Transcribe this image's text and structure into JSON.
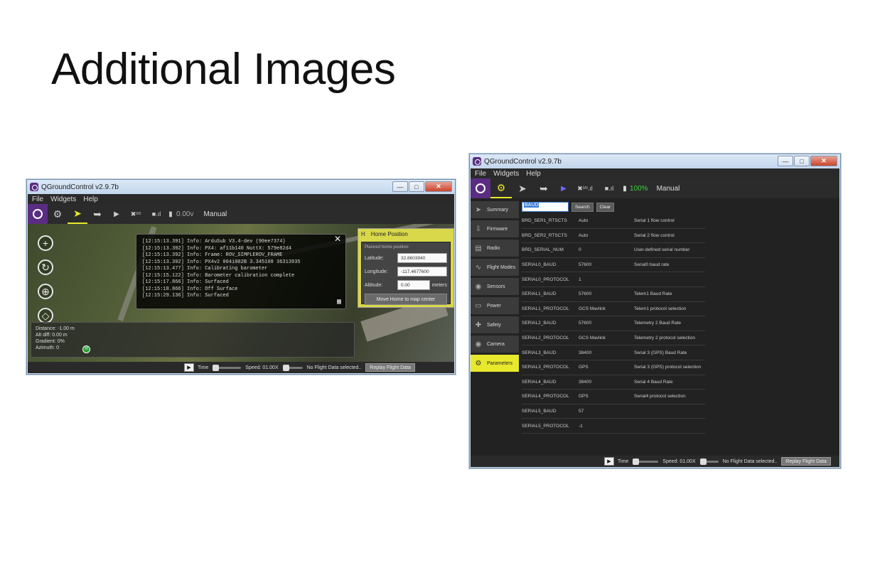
{
  "slide": {
    "title": "Additional Images"
  },
  "window_left": {
    "title": "QGroundControl v2.9.7b",
    "menu": [
      "File",
      "Widgets",
      "Help"
    ],
    "toolbar": {
      "sats": "0/0",
      "voltage": "0.00v",
      "mode": "Manual"
    },
    "console_lines": [
      "[12:15:13.391] Info: ArduSub V3.4-dev (90ee7374)",
      "[12:15:13.392] Info: PX4: af11b140 NuttX: 579e82d4",
      "[12:15:13.392] Info: Frame: ROV_SIMPLEROV_FRAME",
      "[12:15:13.392] Info: PX4v2 004i002B 3.345108 36313935",
      "[12:15:13.477] Info: Calibrating barometer",
      "[12:15:15.122] Info: Barometer calibration complete",
      "[12:15:17.866] Info: Surfaced",
      "[12:15:18.866] Info: Off Surface",
      "[12:15:29.136] Info: Surfaced"
    ],
    "home": {
      "heading": "Home Position",
      "subtitle": "Planned home position:",
      "latitude_label": "Latitude:",
      "latitude": "32.8603940",
      "longitude_label": "Longitude:",
      "longitude": "-117.4677600",
      "altitude_label": "Altitude:",
      "altitude": "0.00",
      "altitude_unit": "meters",
      "move_button": "Move Home to map center"
    },
    "telemetry": {
      "distance": "Distance:   -1.00 m",
      "alt_diff": "Alt diff:    0.00 m",
      "gradient": "Gradient:   0%",
      "azimuth": "Azimuth:    0",
      "home_marker": "H"
    },
    "replay": {
      "time": "Time",
      "speed": "Speed: 01.00X",
      "status": "No Flight Data selected..",
      "button": "Replay Flight Data"
    }
  },
  "window_right": {
    "title": "QGroundControl v2.9.7b",
    "menu": [
      "File",
      "Widgets",
      "Help"
    ],
    "toolbar": {
      "sats": "0/0",
      "battery": "100%",
      "mode": "Manual"
    },
    "sidebar": [
      {
        "label": "Summary",
        "icon": "plane-icon"
      },
      {
        "label": "Firmware",
        "icon": "download-icon"
      },
      {
        "label": "Radio",
        "icon": "radio-icon"
      },
      {
        "label": "Flight Modes",
        "icon": "wave-icon"
      },
      {
        "label": "Sensors",
        "icon": "sensor-icon"
      },
      {
        "label": "Power",
        "icon": "battery-icon"
      },
      {
        "label": "Safety",
        "icon": "plus-icon"
      },
      {
        "label": "Camera",
        "icon": "camera-icon"
      },
      {
        "label": "Parameters",
        "icon": "gears-icon"
      }
    ],
    "search": {
      "value": "BAUD",
      "search_button": "Search",
      "clear_button": "Clear"
    },
    "params": [
      {
        "name": "BRD_SER1_RTSCTS",
        "value": "Auto",
        "desc": "Serial 1 flow control"
      },
      {
        "name": "BRD_SER2_RTSCTS",
        "value": "Auto",
        "desc": "Serial 2 flow control"
      },
      {
        "name": "BRD_SERIAL_NUM",
        "value": "0",
        "desc": "User-defined serial number"
      },
      {
        "name": "SERIAL0_BAUD",
        "value": "57600",
        "desc": "Serial0 baud rate"
      },
      {
        "name": "SERIAL0_PROTOCOL",
        "value": "1",
        "desc": ""
      },
      {
        "name": "SERIAL1_BAUD",
        "value": "57600",
        "desc": "Telem1 Baud Rate"
      },
      {
        "name": "SERIAL1_PROTOCOL",
        "value": "GCS Mavlink",
        "desc": "Telem1 protocol selection"
      },
      {
        "name": "SERIAL2_BAUD",
        "value": "57600",
        "desc": "Telemetry 2 Baud Rate"
      },
      {
        "name": "SERIAL2_PROTOCOL",
        "value": "GCS Mavlink",
        "desc": "Telemetry 2 protocol selection"
      },
      {
        "name": "SERIAL3_BAUD",
        "value": "38400",
        "desc": "Serial 3 (GPS) Baud Rate"
      },
      {
        "name": "SERIAL3_PROTOCOL",
        "value": "GPS",
        "desc": "Serial 3 (GPS) protocol selection"
      },
      {
        "name": "SERIAL4_BAUD",
        "value": "38400",
        "desc": "Serial 4 Baud Rate"
      },
      {
        "name": "SERIAL4_PROTOCOL",
        "value": "GPS",
        "desc": "Serial4 protocol selection"
      },
      {
        "name": "SERIAL5_BAUD",
        "value": "57",
        "desc": ""
      },
      {
        "name": "SERIAL5_PROTOCOL",
        "value": "-1",
        "desc": ""
      }
    ],
    "replay": {
      "time": "Time",
      "speed": "Speed: 01.00X",
      "status": "No Flight Data selected..",
      "button": "Replay Flight Data"
    }
  },
  "colors": {
    "qgc_purple": "#5a2d82",
    "active_yellow": "#e8e82d",
    "battery_green": "#3ecf3e"
  }
}
